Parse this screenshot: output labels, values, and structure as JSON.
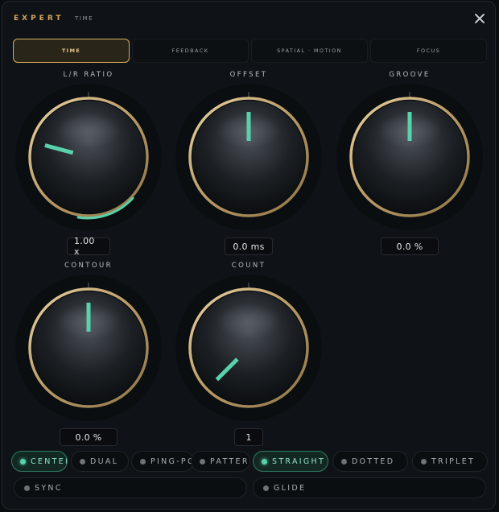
{
  "header": {
    "title": "EXPERT",
    "subtitle": "TIME",
    "close_icon": "close-icon"
  },
  "tabs": [
    {
      "label": "TIME",
      "active": true
    },
    {
      "label": "FEEDBACK",
      "active": false
    },
    {
      "label": "SPATIAL · MOTION",
      "active": false
    },
    {
      "label": "FOCUS",
      "active": false
    }
  ],
  "knobs": [
    {
      "id": "lr-ratio",
      "label": "L/R RATIO",
      "value": "1.00 x",
      "pointer_deg": -75,
      "has_arc": true
    },
    {
      "id": "offset",
      "label": "OFFSET",
      "value": "0.0 ms",
      "pointer_deg": 0,
      "has_arc": false
    },
    {
      "id": "groove",
      "label": "GROOVE",
      "value": "0.0 %",
      "pointer_deg": 0,
      "has_arc": false
    },
    {
      "id": "contour",
      "label": "CONTOUR",
      "value": "0.0 %",
      "pointer_deg": 0,
      "has_arc": false
    },
    {
      "id": "count",
      "label": "COUNT",
      "value": "1",
      "pointer_deg": -135,
      "has_arc": false
    }
  ],
  "modes": [
    {
      "label": "CENTER",
      "active": true
    },
    {
      "label": "DUAL",
      "active": false
    },
    {
      "label": "PING-PC",
      "active": false
    },
    {
      "label": "PATTER",
      "active": false
    }
  ],
  "feel": [
    {
      "label": "STRAIGHT",
      "active": true
    },
    {
      "label": "DOTTED",
      "active": false
    },
    {
      "label": "TRIPLET",
      "active": false
    }
  ],
  "toggles": [
    {
      "label": "SYNC",
      "active": false
    },
    {
      "label": "GLIDE",
      "active": false
    }
  ],
  "colors": {
    "accent_gold": "#d7ac63",
    "accent_teal": "#59d2ac"
  }
}
